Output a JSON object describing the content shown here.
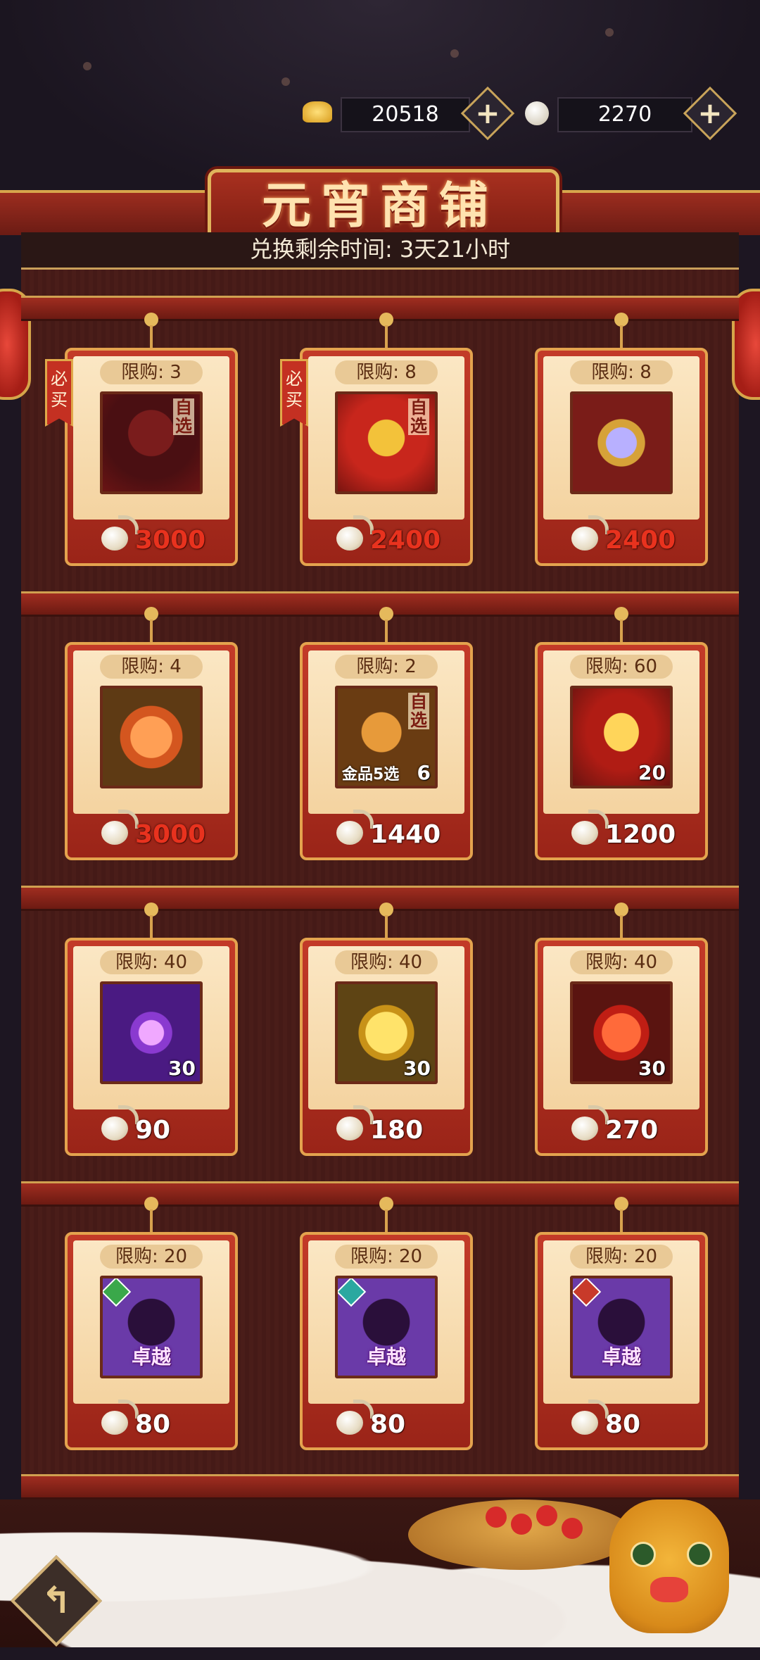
{
  "currency": [
    {
      "name": "gold-ingot",
      "amount": "20518"
    },
    {
      "name": "tangyuan",
      "amount": "2270"
    }
  ],
  "plus_label": "+",
  "shop": {
    "title": "元宵商铺",
    "timer": "兑换剩余时间: 3天21小时"
  },
  "labels": {
    "must_buy": "必买",
    "choose": "自选",
    "gold_pick": "金品5选",
    "excellent": "卓越"
  },
  "items": [
    {
      "limit": "限购: 3",
      "price": "3000",
      "price_color": "red",
      "must_buy": true,
      "choose": true,
      "icon": "silhouette-hero-icon",
      "qty": ""
    },
    {
      "limit": "限购: 8",
      "price": "2400",
      "price_color": "red",
      "must_buy": true,
      "choose": true,
      "icon": "golden-armor-hero-icon",
      "qty": ""
    },
    {
      "limit": "限购: 8",
      "price": "2400",
      "price_color": "red",
      "must_buy": false,
      "choose": false,
      "icon": "crystal-gem-icon",
      "qty": ""
    },
    {
      "limit": "限购: 4",
      "price": "3000",
      "price_color": "red",
      "must_buy": false,
      "choose": false,
      "icon": "flame-stone-icon",
      "qty": ""
    },
    {
      "limit": "限购: 2",
      "price": "1440",
      "price_color": "white",
      "must_buy": false,
      "choose": true,
      "icon": "gold-weapon-icon",
      "qty": "6"
    },
    {
      "limit": "限购: 60",
      "price": "1200",
      "price_color": "white",
      "must_buy": false,
      "choose": false,
      "icon": "treasure-chest-icon",
      "qty": "20"
    },
    {
      "limit": "限购: 40",
      "price": "90",
      "price_color": "white",
      "must_buy": false,
      "choose": false,
      "icon": "purple-star-icon",
      "qty": "30"
    },
    {
      "limit": "限购: 40",
      "price": "180",
      "price_color": "white",
      "must_buy": false,
      "choose": false,
      "icon": "gold-coin-icon",
      "qty": "30"
    },
    {
      "limit": "限购: 40",
      "price": "270",
      "price_color": "white",
      "must_buy": false,
      "choose": false,
      "icon": "fire-orb-icon",
      "qty": "30"
    },
    {
      "limit": "限购: 20",
      "price": "80",
      "price_color": "white",
      "must_buy": false,
      "choose": false,
      "icon": "excellent-hero-green-icon",
      "qty": ""
    },
    {
      "limit": "限购: 20",
      "price": "80",
      "price_color": "white",
      "must_buy": false,
      "choose": false,
      "icon": "excellent-hero-teal-icon",
      "qty": ""
    },
    {
      "limit": "限购: 20",
      "price": "80",
      "price_color": "white",
      "must_buy": false,
      "choose": false,
      "icon": "excellent-hero-red-icon",
      "qty": ""
    }
  ],
  "colors": {
    "price_red": "#e8321e",
    "frame_red": "#c33a28",
    "gold_trim": "#e4a34e"
  }
}
